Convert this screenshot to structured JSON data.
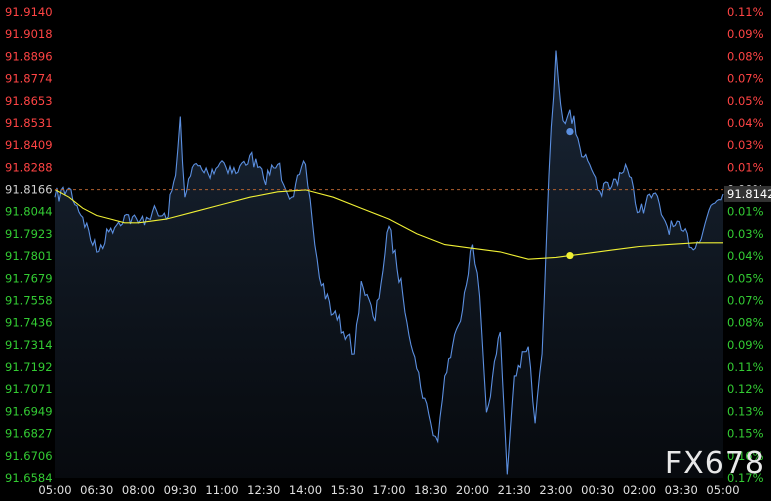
{
  "chart_data": {
    "type": "line",
    "title": "",
    "xlabel": "",
    "ylabel": "",
    "x_ticks": [
      "05:00",
      "06:30",
      "08:00",
      "09:30",
      "11:00",
      "12:30",
      "14:00",
      "15:30",
      "17:00",
      "18:30",
      "20:00",
      "21:30",
      "23:00",
      "00:30",
      "02:00",
      "03:30",
      "05:00"
    ],
    "y_ticks_left": [
      "91.9140",
      "91.9018",
      "91.8896",
      "91.8774",
      "91.8653",
      "91.8531",
      "91.8409",
      "91.8288",
      "91.8166",
      "91.8044",
      "91.7923",
      "91.7801",
      "91.7679",
      "91.7558",
      "91.7436",
      "91.7314",
      "91.7192",
      "91.7071",
      "91.6949",
      "91.6827",
      "91.6706",
      "91.6584"
    ],
    "y_ticks_right": [
      "0.11%",
      "0.09%",
      "0.08%",
      "0.07%",
      "0.05%",
      "0.04%",
      "0.03%",
      "0.01%",
      "0.00%",
      "0.01%",
      "0.03%",
      "0.04%",
      "0.05%",
      "0.07%",
      "0.08%",
      "0.09%",
      "0.11%",
      "0.12%",
      "0.13%",
      "0.15%",
      "0.16%",
      "0.17%"
    ],
    "ylim": [
      91.6584,
      91.914
    ],
    "reference_value": 91.8166,
    "last_price_label": "91.8142",
    "series": [
      {
        "color": "#5b8fe0",
        "x": [
          "05:00",
          "05:30",
          "06:00",
          "06:30",
          "07:00",
          "07:30",
          "08:00",
          "08:30",
          "09:00",
          "09:20",
          "09:30",
          "09:40",
          "10:00",
          "10:30",
          "11:00",
          "11:30",
          "12:00",
          "12:30",
          "13:00",
          "13:30",
          "14:00",
          "14:15",
          "14:30",
          "15:00",
          "15:30",
          "15:45",
          "16:00",
          "16:30",
          "17:00",
          "17:30",
          "18:00",
          "18:30",
          "18:45",
          "19:00",
          "19:30",
          "20:00",
          "20:15",
          "20:30",
          "21:00",
          "21:15",
          "21:30",
          "22:00",
          "22:15",
          "22:30",
          "22:45",
          "23:00",
          "23:15",
          "23:30",
          "00:00",
          "00:30",
          "01:00",
          "01:30",
          "02:00",
          "02:30",
          "03:00",
          "03:30",
          "04:00",
          "04:30",
          "05:00"
        ],
        "values": [
          91.8124,
          91.8174,
          91.8014,
          91.7823,
          91.7954,
          91.8024,
          91.7984,
          91.8044,
          91.8004,
          91.8244,
          91.8567,
          91.8124,
          91.8304,
          91.8254,
          91.8324,
          91.8254,
          91.8354,
          91.8224,
          91.8304,
          91.8124,
          91.8304,
          91.7984,
          91.7684,
          91.7484,
          91.7364,
          91.7264,
          91.7664,
          91.7444,
          91.7964,
          91.7584,
          91.7184,
          91.6884,
          91.6784,
          91.7144,
          91.7424,
          91.7864,
          91.7584,
          91.6944,
          91.7384,
          91.6604,
          91.7144,
          91.7304,
          91.6884,
          91.7264,
          91.8244,
          91.8929,
          91.8544,
          91.8604,
          91.8344,
          91.8164,
          91.8184,
          91.8304,
          91.8044,
          91.8144,
          91.7964,
          91.7944,
          91.7844,
          91.8054,
          91.8142
        ]
      },
      {
        "color": "#f0f034",
        "x": [
          "05:00",
          "05:30",
          "06:00",
          "06:30",
          "07:00",
          "07:30",
          "08:00",
          "09:00",
          "10:00",
          "11:00",
          "12:00",
          "13:00",
          "14:00",
          "15:00",
          "16:00",
          "17:00",
          "18:00",
          "19:00",
          "20:00",
          "21:00",
          "22:00",
          "23:00",
          "23:30",
          "00:00",
          "01:00",
          "02:00",
          "03:00",
          "04:00",
          "05:00"
        ],
        "values": [
          91.8166,
          91.8124,
          91.8064,
          91.8024,
          91.8004,
          91.7984,
          91.7984,
          91.8004,
          91.8044,
          91.8084,
          91.8124,
          91.8154,
          91.8164,
          91.8124,
          91.8064,
          91.8004,
          91.7924,
          91.7864,
          91.7844,
          91.7824,
          91.7784,
          91.7794,
          91.7804,
          91.7814,
          91.7834,
          91.7854,
          91.7864,
          91.7874,
          91.7874
        ]
      }
    ],
    "markers": [
      {
        "series": 0,
        "x": "23:30",
        "y": 91.8484
      },
      {
        "series": 1,
        "x": "23:30",
        "y": 91.7804
      }
    ],
    "colors": {
      "background": "#000000",
      "area_top": "#1a2738",
      "axis_positive": "#ff4444",
      "axis_negative": "#33cc33",
      "axis_neutral": "#d0d0d0",
      "x_axis_label": "#e0e0e0",
      "reference_line": "#b06030",
      "price_tag": "#333333"
    },
    "grid": false
  },
  "watermark": "FX678"
}
